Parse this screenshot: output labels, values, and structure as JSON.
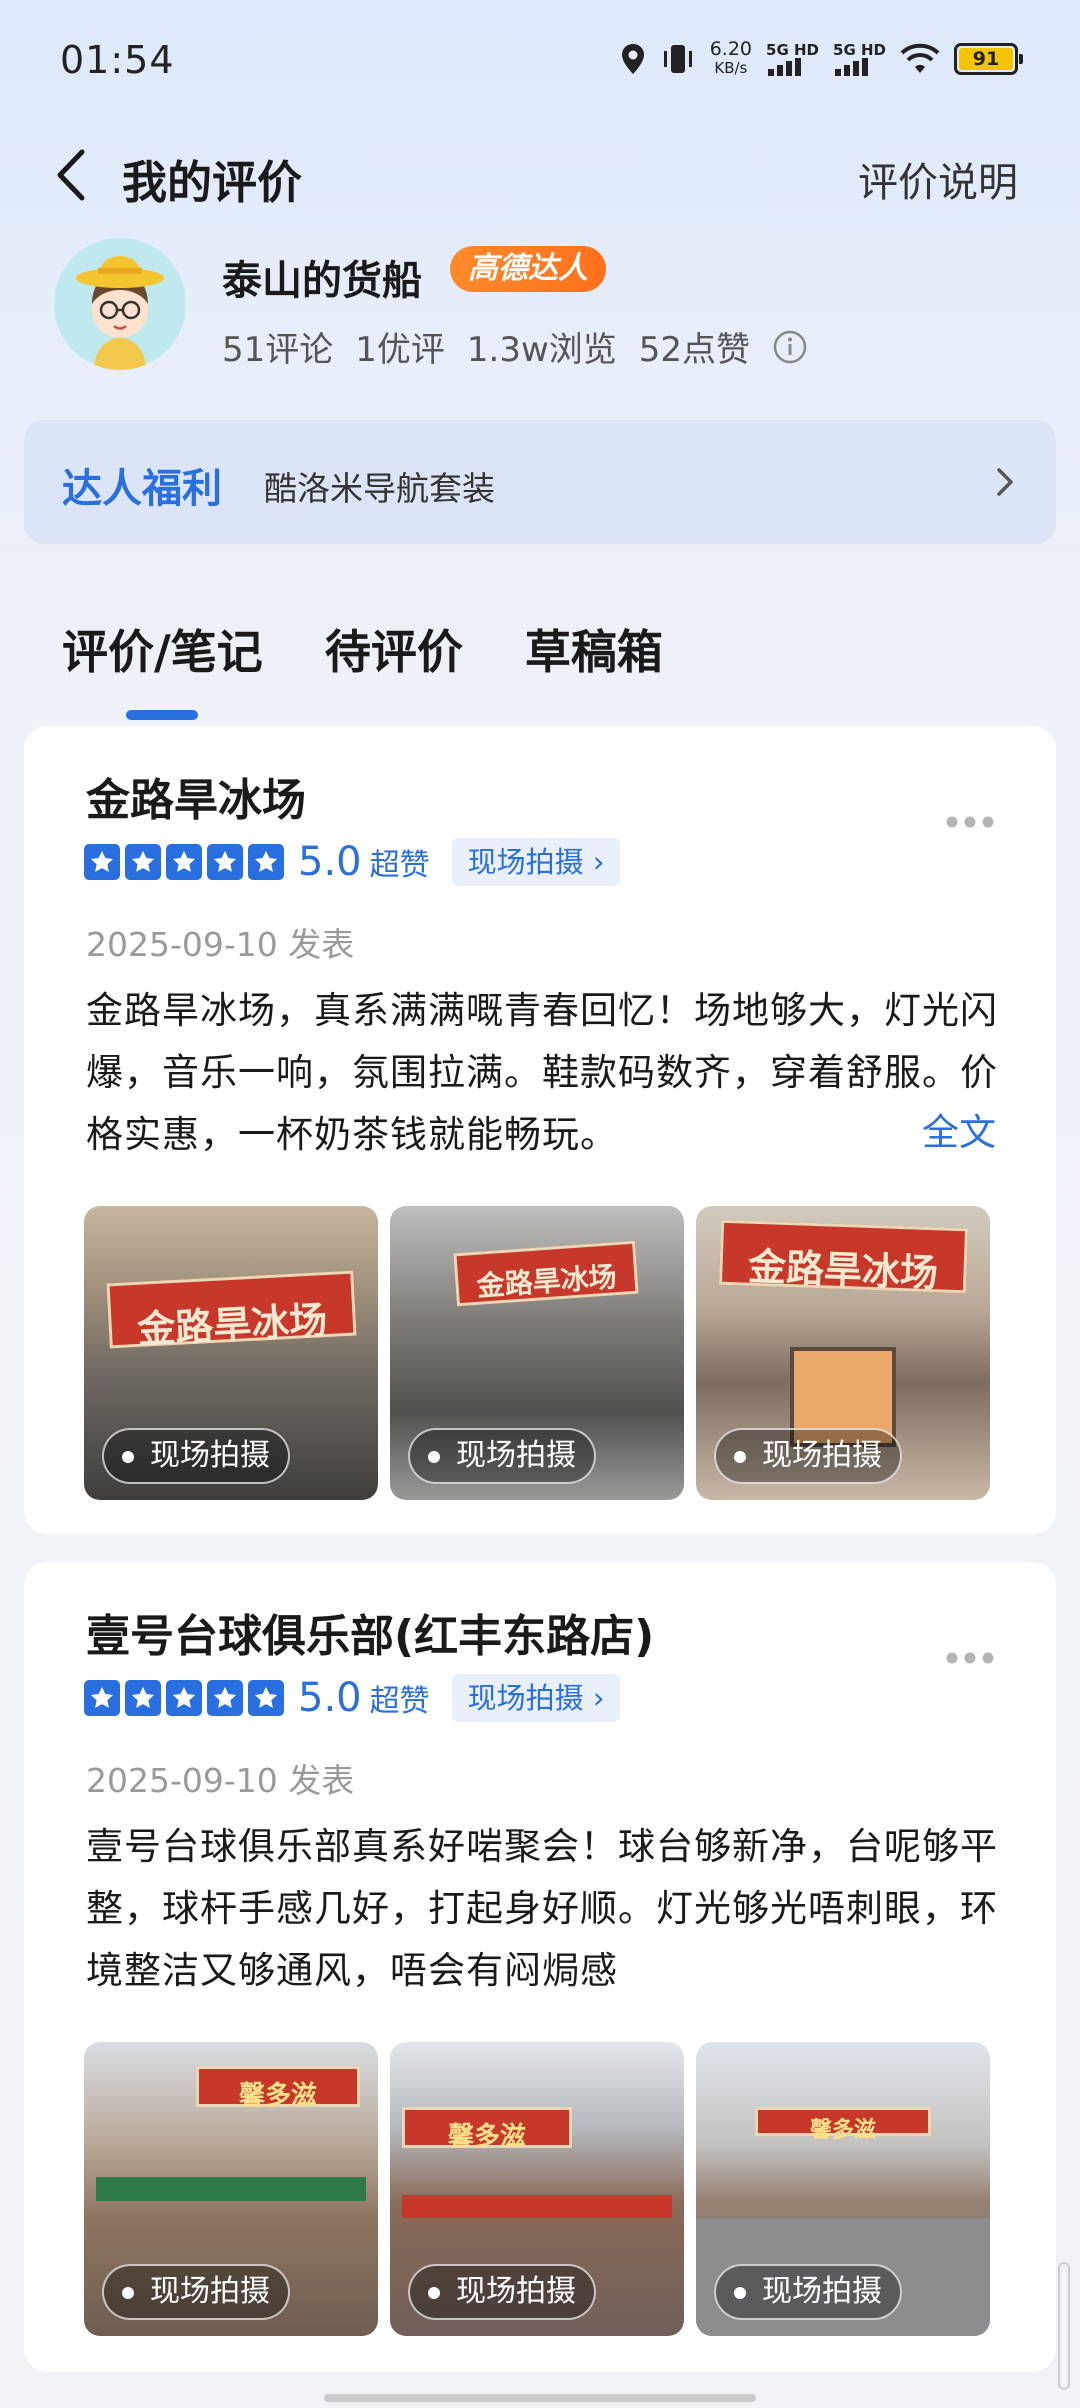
{
  "status_bar": {
    "time": "01:54",
    "net_speed_value": "6.20",
    "net_speed_unit": "KB/s",
    "sim1_label": "5G HD",
    "sim2_label": "5G HD",
    "battery_level": "91",
    "icons": [
      "location-icon",
      "vibrate-icon",
      "signal-icon",
      "wifi-icon",
      "battery-icon"
    ]
  },
  "header": {
    "title": "我的评价",
    "help_link": "评价说明"
  },
  "profile": {
    "username": "泰山的货船",
    "badge": "高德达人",
    "stats": {
      "comments": "51评论",
      "good": "1优评",
      "views": "1.3w浏览",
      "likes": "52点赞"
    }
  },
  "perk": {
    "title": "达人福利",
    "description": "酷洛米导航套装"
  },
  "tabs": [
    {
      "label": "评价/笔记",
      "active": true
    },
    {
      "label": "待评价",
      "active": false
    },
    {
      "label": "草稿箱",
      "active": false
    }
  ],
  "colors": {
    "accent": "#2a6fe0",
    "badge": "#ff7a24"
  },
  "reviews": [
    {
      "place": "金路旱冰场",
      "score": "5.0",
      "score_label": "超赞",
      "live_tag": "现场拍摄",
      "date": "2025-09-10 发表",
      "content": "金路旱冰场，真系满满嘅青春回忆！场地够大，灯光闪爆，音乐一响，氛围拉满。鞋款码数齐，穿着舒服。价格实惠，一杯奶茶钱就能畅玩。",
      "fulltext_label": "全文",
      "photos": [
        {
          "tag": "现场拍摄",
          "sign": "金路旱冰场"
        },
        {
          "tag": "现场拍摄",
          "sign": "金路旱冰场"
        },
        {
          "tag": "现场拍摄",
          "sign": "金路旱冰场"
        }
      ]
    },
    {
      "place": "壹号台球俱乐部(红丰东路店)",
      "score": "5.0",
      "score_label": "超赞",
      "live_tag": "现场拍摄",
      "date": "2025-09-10 发表",
      "content": "壹号台球俱乐部真系好啱聚会！球台够新净，台呢够平整，球杆手感几好，打起身好顺。灯光够光唔刺眼，环境整洁又够通风，唔会有闷焗感",
      "photos": [
        {
          "tag": "现场拍摄",
          "sign": "馨多滋"
        },
        {
          "tag": "现场拍摄",
          "sign": "馨多滋"
        },
        {
          "tag": "现场拍摄",
          "sign": "馨多滋"
        }
      ]
    }
  ]
}
